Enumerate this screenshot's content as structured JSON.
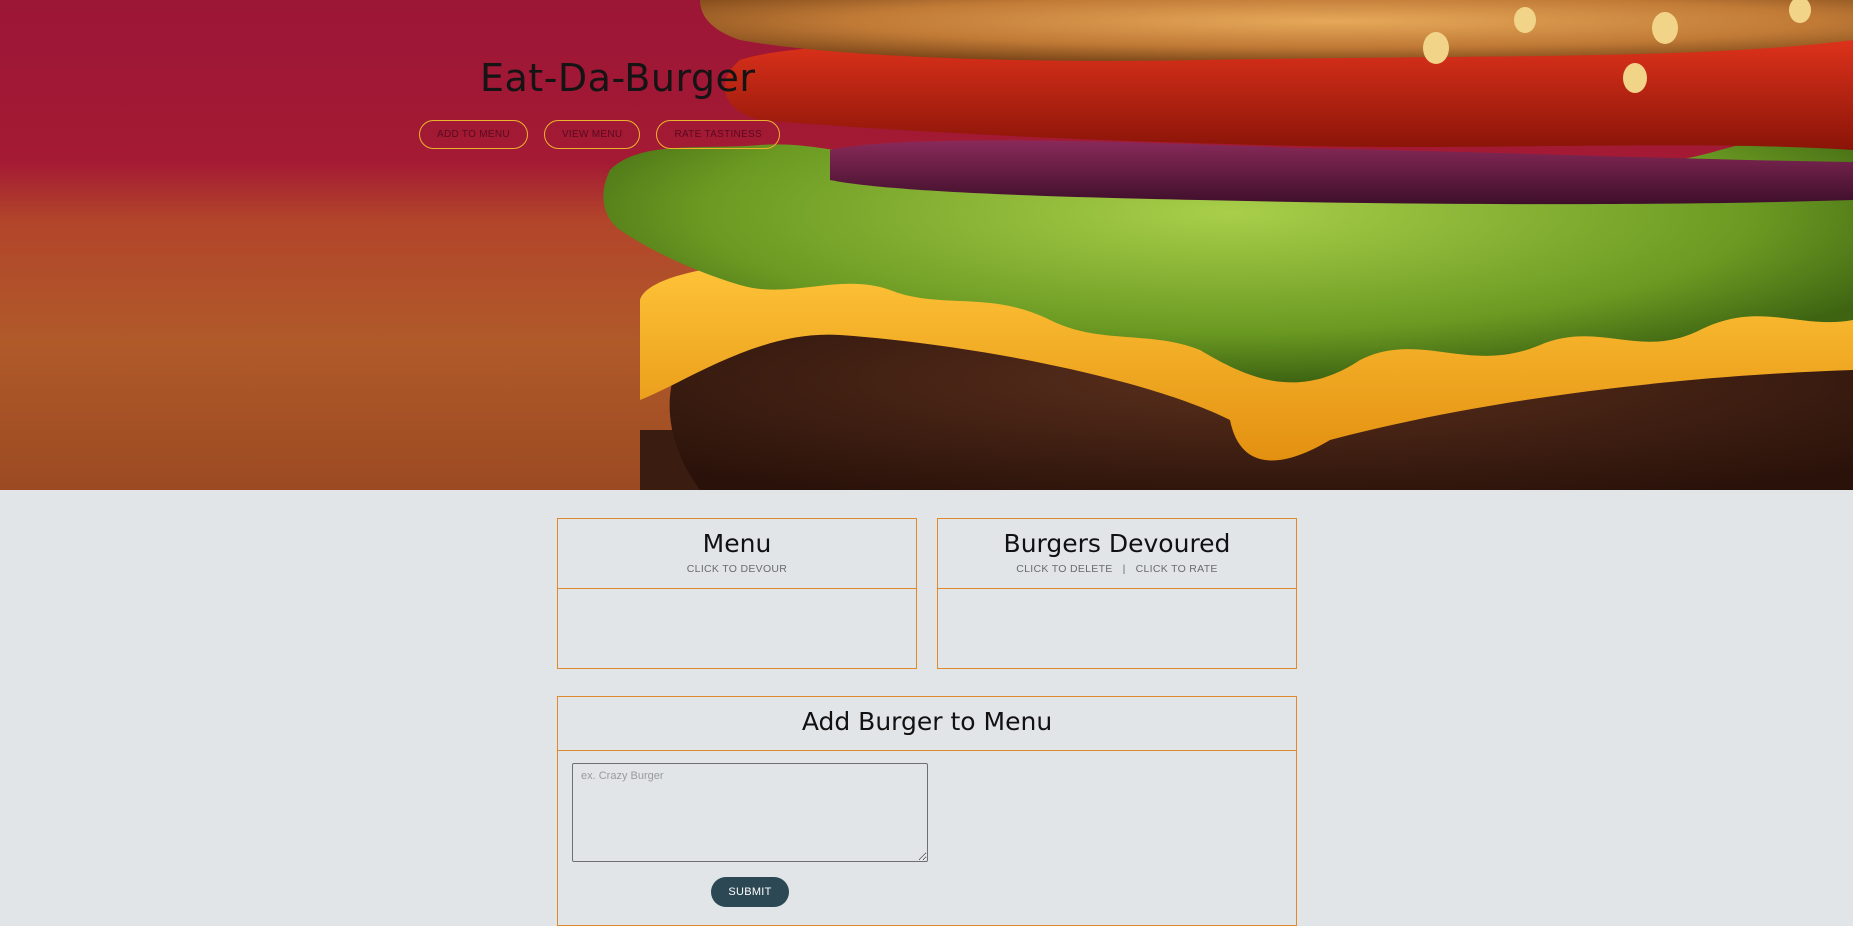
{
  "hero": {
    "title": "Eat-Da-Burger",
    "nav": [
      {
        "label": "ADD TO MENU"
      },
      {
        "label": "VIEW MENU"
      },
      {
        "label": "RATE TASTINESS"
      }
    ]
  },
  "menu_card": {
    "title": "Menu",
    "subtitle": "CLICK TO DEVOUR"
  },
  "devoured_card": {
    "title": "Burgers Devoured",
    "subtitle_left": "CLICK TO DELETE",
    "separator": "|",
    "subtitle_right": "CLICK TO RATE"
  },
  "add_card": {
    "title": "Add Burger to Menu",
    "input_placeholder": "ex. Crazy Burger",
    "input_value": "",
    "submit_label": "SUBMIT"
  },
  "colors": {
    "accent_border": "#e0882c",
    "pill_border": "#ecb22e",
    "submit_bg": "#2c4854",
    "page_bg": "#e1e5e8",
    "hero_top": "#a41a34"
  }
}
